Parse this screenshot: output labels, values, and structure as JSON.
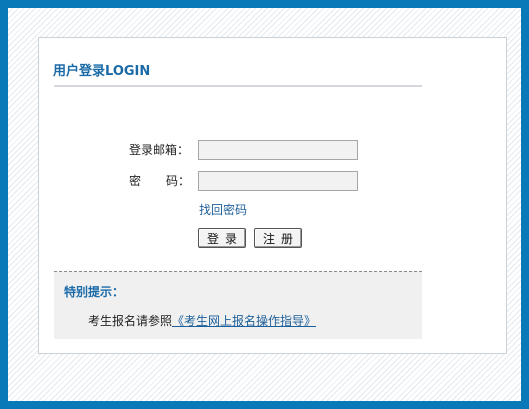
{
  "login": {
    "title": "用户登录LOGIN",
    "email_label": "登录邮箱：",
    "password_label_left": "密",
    "password_label_right": "码：",
    "email_value": "",
    "password_value": "",
    "forgot_link": "找回密码",
    "login_button": "登录",
    "register_button": "注册"
  },
  "notice": {
    "title": "特别提示：",
    "text": "考生报名请参照",
    "link": "《考生网上报名操作指导》"
  },
  "colors": {
    "frame": "#0a79b8",
    "title": "#1a6aa8",
    "link": "#1c5f9a"
  }
}
